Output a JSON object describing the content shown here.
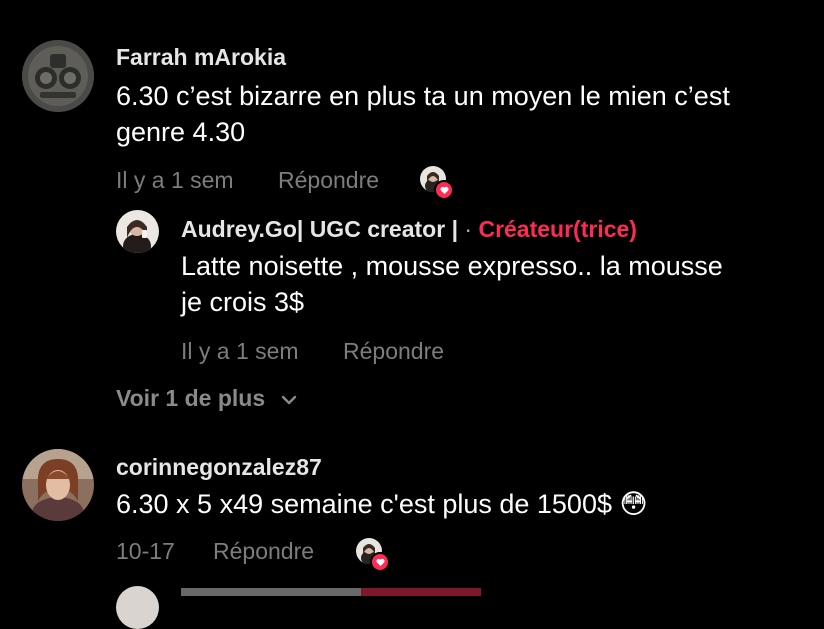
{
  "colors": {
    "background": "#000000",
    "username": "#e6e6e6",
    "meta": "#7d7d7d",
    "creator_accent": "#fe2c55",
    "heart": "#fe2c55"
  },
  "comments": [
    {
      "username": "Farrah mArokia",
      "text_line1": "6.30 c’est bizarre en plus ta un moyen le mien c’est",
      "text_line2": "genre 4.30",
      "time": "Il y a 1 sem",
      "reply_label": "Répondre",
      "liked_by_creator": true,
      "avatar_icon": "badge-emblem-avatar"
    },
    {
      "username": "corinnegonzalez87",
      "text": "6.30 x 5 x49 semaine c'est plus de 1500$ 😳",
      "time": "10-17",
      "reply_label": "Répondre",
      "liked_by_creator": true,
      "avatar_icon": "woman-portrait-avatar"
    }
  ],
  "reply": {
    "username": "Audrey.Go| UGC creator |",
    "separator": "·",
    "creator_badge": "Créateur(trice)",
    "text_line1": "Latte noisette , mousse expresso.. la mousse",
    "text_line2": "je crois 3$",
    "time": "Il y a 1 sem",
    "reply_label": "Répondre"
  },
  "view_more": {
    "label": "Voir 1 de plus",
    "icon": "chevron-down-icon"
  }
}
